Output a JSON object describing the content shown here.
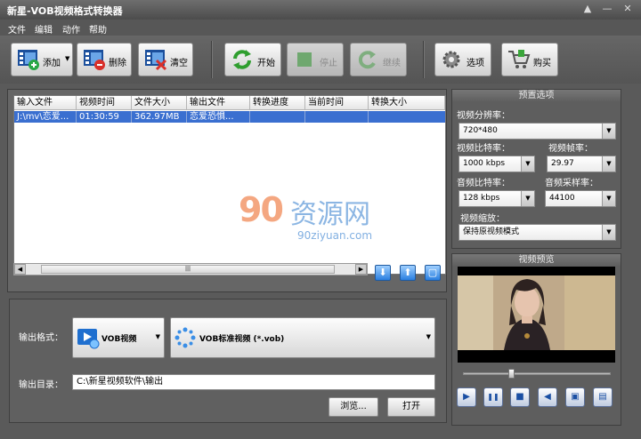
{
  "window": {
    "title": "新星-VOB视频格式转换器",
    "controls": [
      "▲",
      "—",
      "✕"
    ]
  },
  "menu": [
    "文件",
    "编辑",
    "动作",
    "帮助"
  ],
  "toolbar": {
    "add": "添加",
    "delete": "删除",
    "clear": "清空",
    "start": "开始",
    "stop": "停止",
    "resume": "继续",
    "options": "选项",
    "buy": "购买"
  },
  "filelist": {
    "columns": [
      "输入文件",
      "视频时间",
      "文件大小",
      "输出文件",
      "转换进度",
      "当前时间",
      "转换大小"
    ],
    "rows": [
      [
        "J:\\mv\\恋爱...",
        "01:30:59",
        "362.97MB",
        "恋爱恐惧...",
        "",
        "",
        ""
      ]
    ]
  },
  "scroll": {
    "left": "◀",
    "right": "▶",
    "grip": "|||"
  },
  "list_buttons": [
    "⬇",
    "⬆",
    "▢"
  ],
  "output": {
    "format_label": "输出格式：",
    "format_type": "VOB视频",
    "format_detail": "VOB标准视频 (*.vob)",
    "dir_label": "输出目录：",
    "dir_value": "C:\\新星视频软件\\输出",
    "browse": "浏览...",
    "open": "打开"
  },
  "preset": {
    "title": "预置选项",
    "resolution_label": "视频分辨率：",
    "resolution": "720*480",
    "vbitrate_label": "视频比特率：",
    "vbitrate": "1000 kbps",
    "framerate_label": "视频帧率：",
    "framerate": "29.97",
    "abitrate_label": "音频比特率：",
    "abitrate": "128 kbps",
    "samplerate_label": "音频采样率：",
    "samplerate": "44100",
    "scale_label": "视频缩放：",
    "scale": "保持原视频模式"
  },
  "preview": {
    "title": "视频预览",
    "buttons": [
      "▶",
      "❚❚",
      "■",
      "◀",
      "▣",
      "▤"
    ]
  },
  "watermark": {
    "number": "90",
    "text": "资源网",
    "url": "90ziyuan.com"
  },
  "colors": {
    "selection": "#3a6fd0",
    "chrome": "#5a5a5a"
  }
}
